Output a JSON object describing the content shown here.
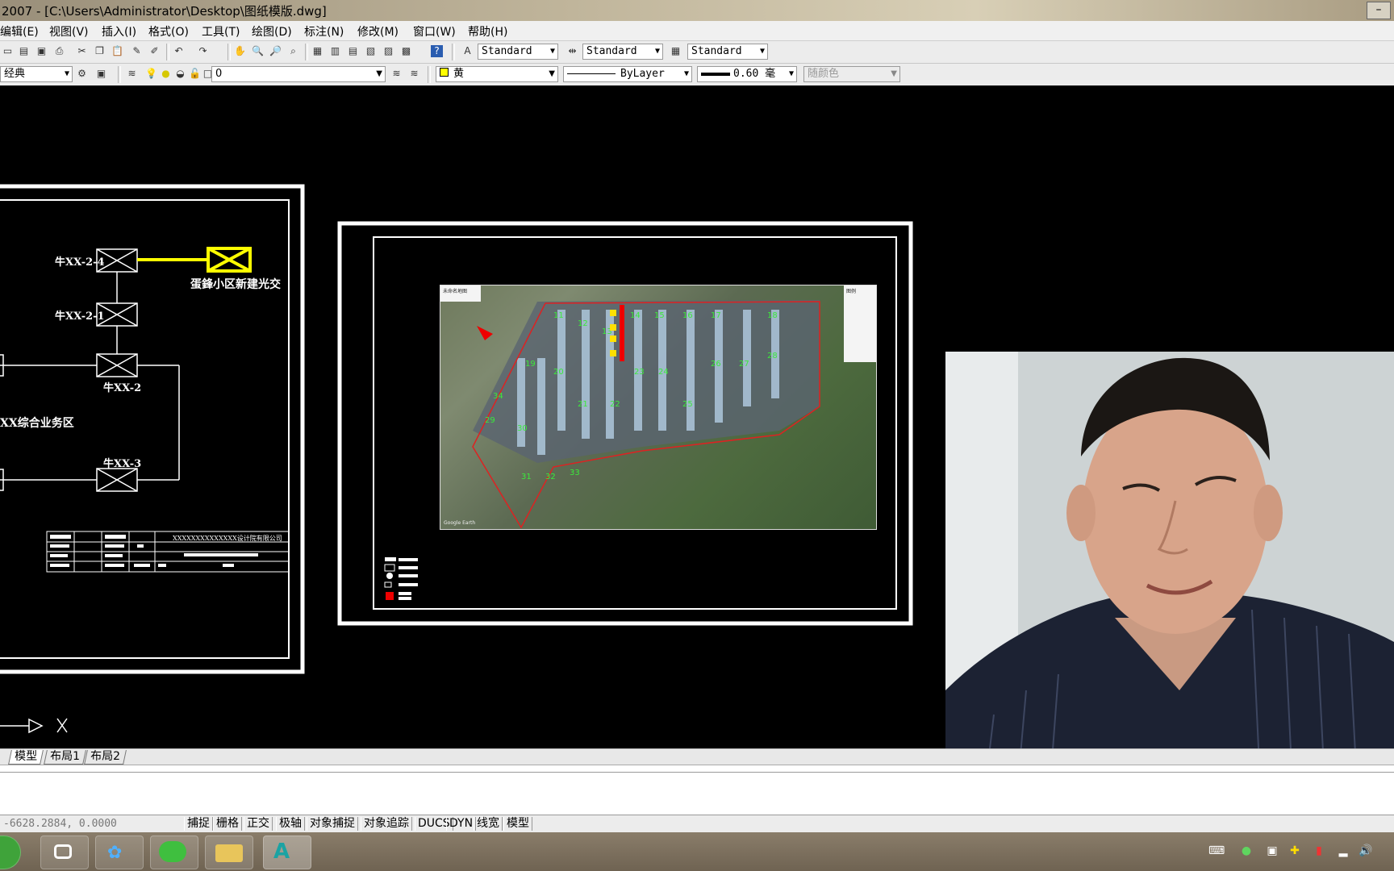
{
  "window": {
    "title": "2007 - [C:\\Users\\Administrator\\Desktop\\图纸模版.dwg]"
  },
  "menu": [
    "编辑(E)",
    "视图(V)",
    "插入(I)",
    "格式(O)",
    "工具(T)",
    "绘图(D)",
    "标注(N)",
    "修改(M)",
    "窗口(W)",
    "帮助(H)"
  ],
  "toolbar1": {
    "text_style": "Standard",
    "dim_style": "Standard",
    "table_style": "Standard"
  },
  "toolbar2": {
    "workspace": "经典",
    "layer": "0",
    "color": "黄",
    "linetype": "ByLayer",
    "lineweight": "0.60 毫",
    "plot_style": "随颜色"
  },
  "diagram": {
    "nodes": [
      "牛XX-2-4",
      "牛XX-2-1",
      "牛XX-2",
      "牛XX-3"
    ],
    "new_box_label": "蛋鋒小区新建光交",
    "area_label": "XX综合业务区",
    "company": "XXXXXXXXXXXXXX设计院有限公司"
  },
  "map": {
    "header": "未命名地图",
    "legend_title": "图例",
    "watermark": "Google Earth"
  },
  "axis": {
    "x_label": "X"
  },
  "tabs": [
    "模型",
    "布局1",
    "布局2"
  ],
  "status": {
    "coords": "-6628.2884, 0.0000",
    "toggles": [
      "捕捉",
      "栅格",
      "正交",
      "极轴",
      "对象捕捉",
      "对象追踪",
      "DUCS",
      "DYN",
      "线宽",
      "模型"
    ]
  },
  "colors": {
    "cad_background": "#000000",
    "highlight": "#ffff00",
    "frame": "#ffffff"
  },
  "icons": [
    "wechat-icon",
    "video-icon",
    "baidu-netdisk-icon",
    "wechat-app-icon",
    "folder-icon",
    "autocad-icon"
  ]
}
